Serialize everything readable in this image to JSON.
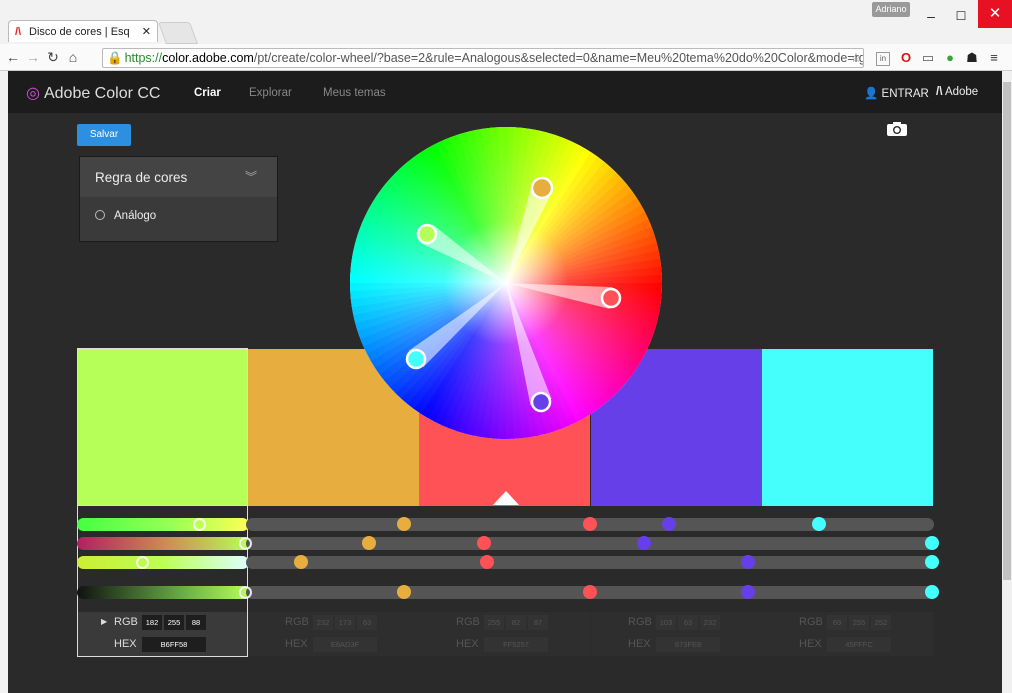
{
  "browser": {
    "tab_title": "Disco de cores | Esquemas",
    "tab_close": "✕",
    "user_badge": "Adriano",
    "url_scheme": "https://",
    "url_domain": "color.adobe.com",
    "url_path": "/pt/create/color-wheel/?base=2&rule=Analogous&selected=0&name=Meu%20tema%20do%20Color&mode=rg",
    "window": {
      "minimize": "–",
      "maximize": "☐",
      "close": "✕"
    }
  },
  "app": {
    "brand": "Adobe Color CC",
    "nav": [
      {
        "label": "Criar",
        "active": true
      },
      {
        "label": "Explorar",
        "active": false
      },
      {
        "label": "Meus temas",
        "active": false
      }
    ],
    "sign_in": "ENTRAR",
    "adobe": "Adobe",
    "save_button": "Salvar",
    "camera_icon": "camera-icon"
  },
  "color_rule": {
    "title": "Regra de cores",
    "selected": "Análogo"
  },
  "swatches": [
    {
      "hex": "B6FF58",
      "rgb": [
        "182",
        "255",
        "88"
      ],
      "color": "#B6FF58",
      "selected": true
    },
    {
      "hex": "E8AD3F",
      "rgb": [
        "232",
        "173",
        "63"
      ],
      "color": "#E8AD3F",
      "selected": false
    },
    {
      "hex": "FF5257",
      "rgb": [
        "255",
        "82",
        "87"
      ],
      "color": "#FF5257",
      "selected": false
    },
    {
      "hex": "673FE8",
      "rgb": [
        "103",
        "63",
        "232"
      ],
      "color": "#673FE8",
      "selected": false
    },
    {
      "hex": "45FFFC",
      "rgb": [
        "69",
        "255",
        "252"
      ],
      "color": "#45FFFC",
      "selected": false
    }
  ],
  "info_labels": {
    "rgb": "RGB",
    "hex": "HEX"
  }
}
